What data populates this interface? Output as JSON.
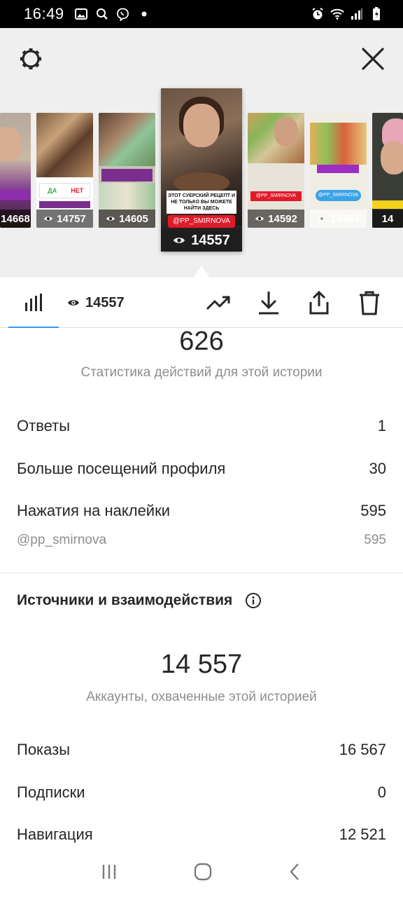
{
  "status_bar": {
    "time": "16:49"
  },
  "stories": [
    {
      "views": "14668"
    },
    {
      "views": "14757",
      "poll_yes": "ДА",
      "poll_no": "НЕТ"
    },
    {
      "views": "14605"
    },
    {
      "views": "14557",
      "caption": "ЭТОТ СУЕРСКИЙ РЕЦЕПТ И НЕ ТОЛЬКО ВЫ МОЖЕТЕ НАЙТИ ЗДЕСЬ",
      "mention": "@PP_SMIRNOVA",
      "selected": true
    },
    {
      "views": "14592",
      "mention": "@PP_SMIRNOVA"
    },
    {
      "views": "14384",
      "mention": "@PP_SMIRNOVA"
    },
    {
      "views": "14"
    }
  ],
  "tabs": {
    "views": "14557"
  },
  "interactions": {
    "total": "626",
    "caption": "Статистика действий для этой истории",
    "rows": [
      {
        "label": "Ответы",
        "value": "1"
      },
      {
        "label": "Больше посещений профиля",
        "value": "30"
      },
      {
        "label": "Нажатия на наклейки",
        "value": "595"
      }
    ],
    "sticker_sub": {
      "label": "@pp_smirnova",
      "value": "595"
    }
  },
  "discovery": {
    "title": "Источники и взаимодействия",
    "reach": "14 557",
    "caption": "Аккаунты, охваченные этой историей",
    "rows": [
      {
        "label": "Показы",
        "value": "16 567"
      },
      {
        "label": "Подписки",
        "value": "0"
      },
      {
        "label": "Навигация",
        "value": "12 521"
      }
    ]
  }
}
